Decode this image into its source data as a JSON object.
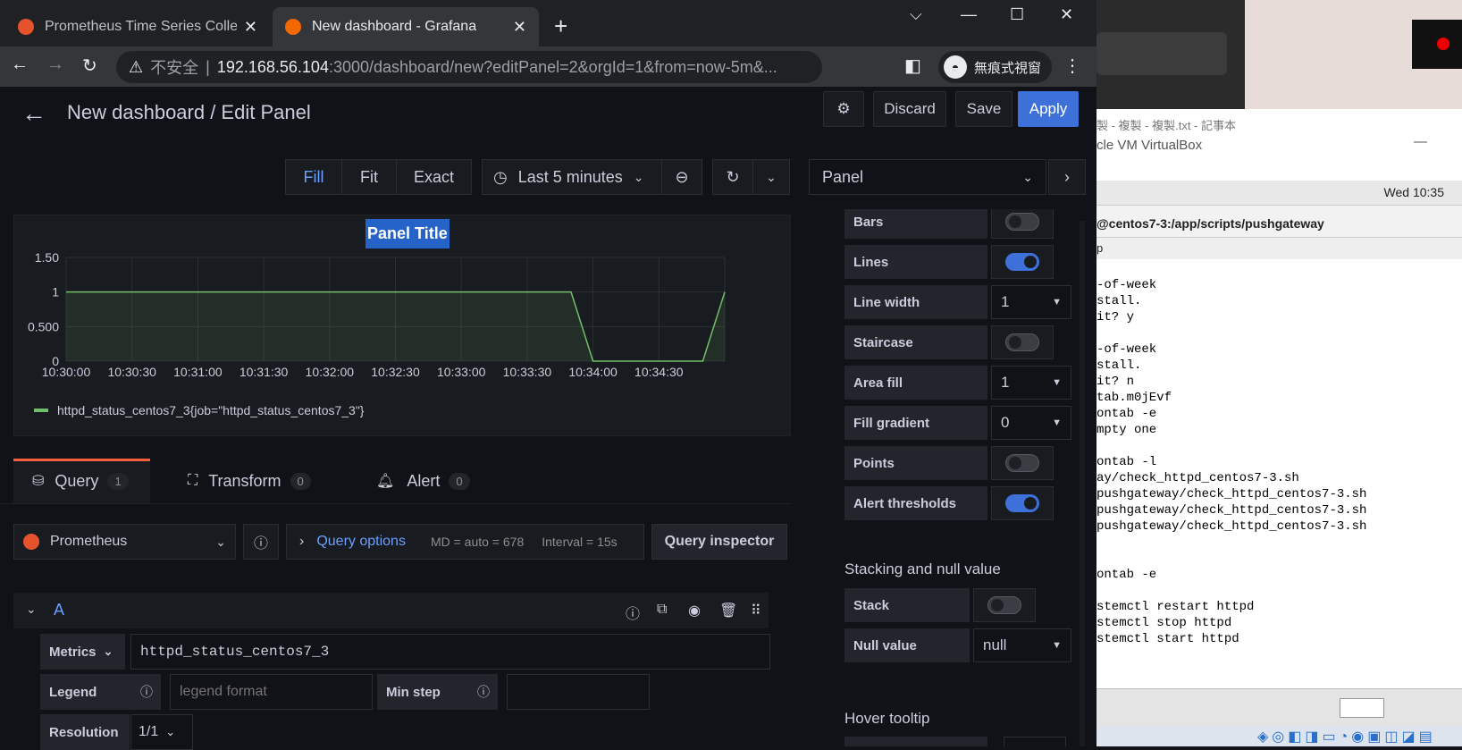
{
  "browser": {
    "tab1_title": "Prometheus Time Series Collect",
    "tab2_title": "New dashboard - Grafana",
    "insecure_label": "不安全",
    "url_host": "192.168.56.104",
    "url_path": ":3000/dashboard/new?editPanel=2&orgId=1&from=now-5m&...",
    "incognito_label": "無痕式視窗"
  },
  "header": {
    "title": "New dashboard / Edit Panel",
    "discard": "Discard",
    "save": "Save",
    "apply": "Apply"
  },
  "viewmodes": {
    "fill": "Fill",
    "fit": "Fit",
    "exact": "Exact"
  },
  "timepicker": {
    "range": "Last 5 minutes"
  },
  "pane_select": "Panel",
  "panel": {
    "title": "Panel Title",
    "legend": "httpd_status_centos7_3{job=\"httpd_status_centos7_3\"}"
  },
  "chart_data": {
    "type": "line",
    "title": "Panel Title",
    "x": [
      "10:30:00",
      "10:30:30",
      "10:31:00",
      "10:31:30",
      "10:32:00",
      "10:32:30",
      "10:33:00",
      "10:33:30",
      "10:33:50",
      "10:34:00",
      "10:34:30",
      "10:34:50",
      "10:35:00"
    ],
    "series": [
      {
        "name": "httpd_status_centos7_3{job=\"httpd_status_centos7_3\"}",
        "values": [
          1,
          1,
          1,
          1,
          1,
          1,
          1,
          1,
          1,
          0,
          0,
          0,
          1
        ]
      }
    ],
    "xticks": [
      "10:30:00",
      "10:30:30",
      "10:31:00",
      "10:31:30",
      "10:32:00",
      "10:32:30",
      "10:33:00",
      "10:33:30",
      "10:34:00",
      "10:34:30"
    ],
    "yticks": [
      "0",
      "0.500",
      "1",
      "1.50"
    ],
    "ylim": [
      0,
      1.5
    ],
    "color": "#73bf69",
    "fill": true,
    "grid": true,
    "legend": "bottom-left"
  },
  "query_tabs": [
    {
      "label": "Query",
      "count": "1"
    },
    {
      "label": "Transform",
      "count": "0"
    },
    {
      "label": "Alert",
      "count": "0"
    }
  ],
  "query": {
    "datasource": "Prometheus",
    "options_label": "Query options",
    "md": "MD = auto = 678",
    "interval": "Interval = 15s",
    "inspector": "Query inspector",
    "ref": "A",
    "metrics_label": "Metrics",
    "metric_value": "httpd_status_centos7_3",
    "legend_label": "Legend",
    "legend_placeholder": "legend format",
    "minstep_label": "Min step",
    "resolution_label": "Resolution",
    "resolution_value": "1/1"
  },
  "options": {
    "bars": "Bars",
    "lines": "Lines",
    "line_width": "Line width",
    "line_width_value": "1",
    "staircase": "Staircase",
    "area_fill": "Area fill",
    "area_fill_value": "1",
    "fill_gradient": "Fill gradient",
    "fill_gradient_value": "0",
    "points": "Points",
    "alert_thresholds": "Alert thresholds",
    "stacking_heading": "Stacking and null value",
    "stack": "Stack",
    "null_value": "Null value",
    "null_value_value": "null",
    "hover_heading": "Hover tooltip"
  },
  "background_window": {
    "notepad_title": "製 - 複製 - 複製.txt - 記事本",
    "vbox_title": "cle VM VirtualBox",
    "clock": "Wed 10:35",
    "term_title": "@centos7-3:/app/scripts/pushgateway",
    "menu": "p",
    "terminal_lines": "-of-week\nstall.\nit? y\n\n-of-week\nstall.\nit? n\ntab.m0jEvf\nontab -e\nmpty one\n\nontab -l\nay/check_httpd_centos7-3.sh\npushgateway/check_httpd_centos7-3.sh\npushgateway/check_httpd_centos7-3.sh\npushgateway/check_httpd_centos7-3.sh\n\n\nontab -e\n\nstemctl restart httpd\nstemctl stop httpd\nstemctl start httpd"
  }
}
